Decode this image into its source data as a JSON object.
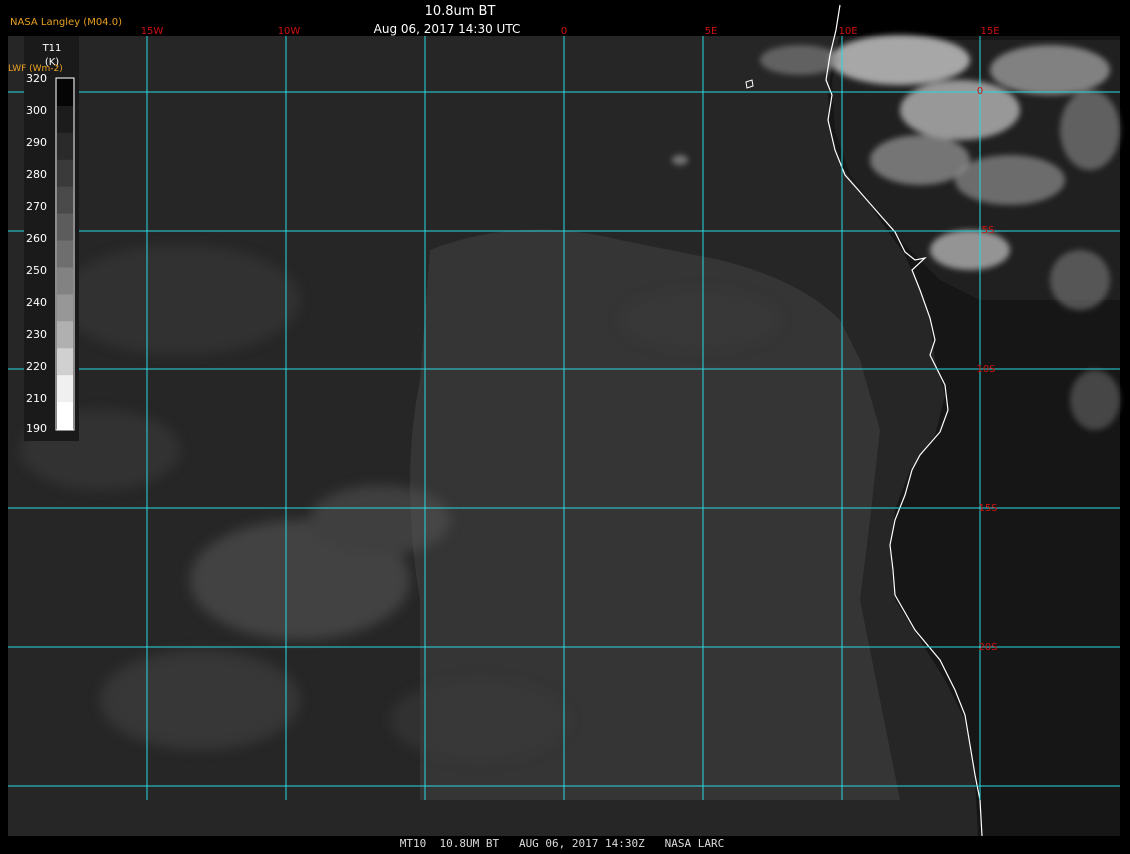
{
  "header": {
    "title": "10.8um BT",
    "datetime": "Aug 06, 2017 14:30 UTC",
    "source": "NASA Langley (M04.0)",
    "lwf": "LWF (Wm-2)"
  },
  "footer": {
    "caption": "MT10  10.8UM BT   AUG 06, 2017 14:30Z   NASA LARC"
  },
  "colorbar": {
    "title": "T11",
    "unit": "(K)",
    "ticks": [
      "320",
      "300",
      "290",
      "280",
      "270",
      "260",
      "250",
      "240",
      "230",
      "220",
      "210",
      "190"
    ]
  },
  "map": {
    "lon_labels": [
      "15W",
      "10W",
      "0",
      "5E",
      "10E",
      "15E"
    ],
    "lat_labels": [
      "0",
      "5S",
      "10S",
      "15S",
      "20S"
    ],
    "colors": {
      "grid": "#2ad8e0",
      "grid_label": "#d01010",
      "coast": "#ffffff",
      "header_orange": "#e8a020"
    }
  }
}
